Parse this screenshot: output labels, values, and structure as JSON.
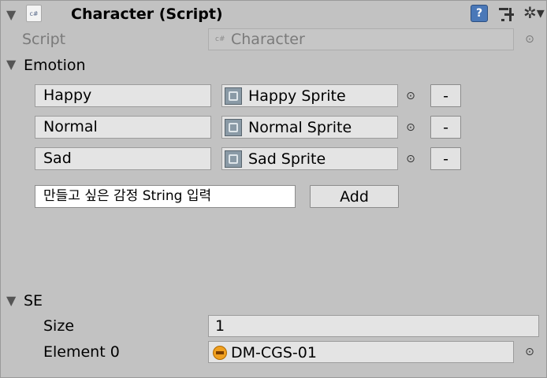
{
  "header": {
    "title": "Character (Script)",
    "cs_icon_label": "c#",
    "help_icon": "help-icon",
    "preset_icon": "preset-icon",
    "gear_icon": "gear-icon",
    "gear_glyph": "✲▾"
  },
  "script_row": {
    "label": "Script",
    "value": "Character",
    "file_glyph": "c#"
  },
  "emotion": {
    "label": "Emotion",
    "rows": [
      {
        "name": "Happy",
        "sprite": "Happy Sprite",
        "remove_label": "-"
      },
      {
        "name": "Normal",
        "sprite": "Normal Sprite",
        "remove_label": "-"
      },
      {
        "name": "Sad",
        "sprite": "Sad Sprite",
        "remove_label": "-"
      }
    ],
    "input_value": "만들고 싶은 감정 String 입력",
    "add_label": "Add"
  },
  "se": {
    "label": "SE",
    "size_label": "Size",
    "size_value": "1",
    "element_label": "Element 0",
    "element_value": "DM-CGS-01"
  },
  "glyphs": {
    "fold_open": "▼",
    "target": "⊙"
  },
  "colors": {
    "panel_bg": "#c2c2c2",
    "field_bg": "#e4e4e4",
    "help_blue": "#4a78b8"
  }
}
